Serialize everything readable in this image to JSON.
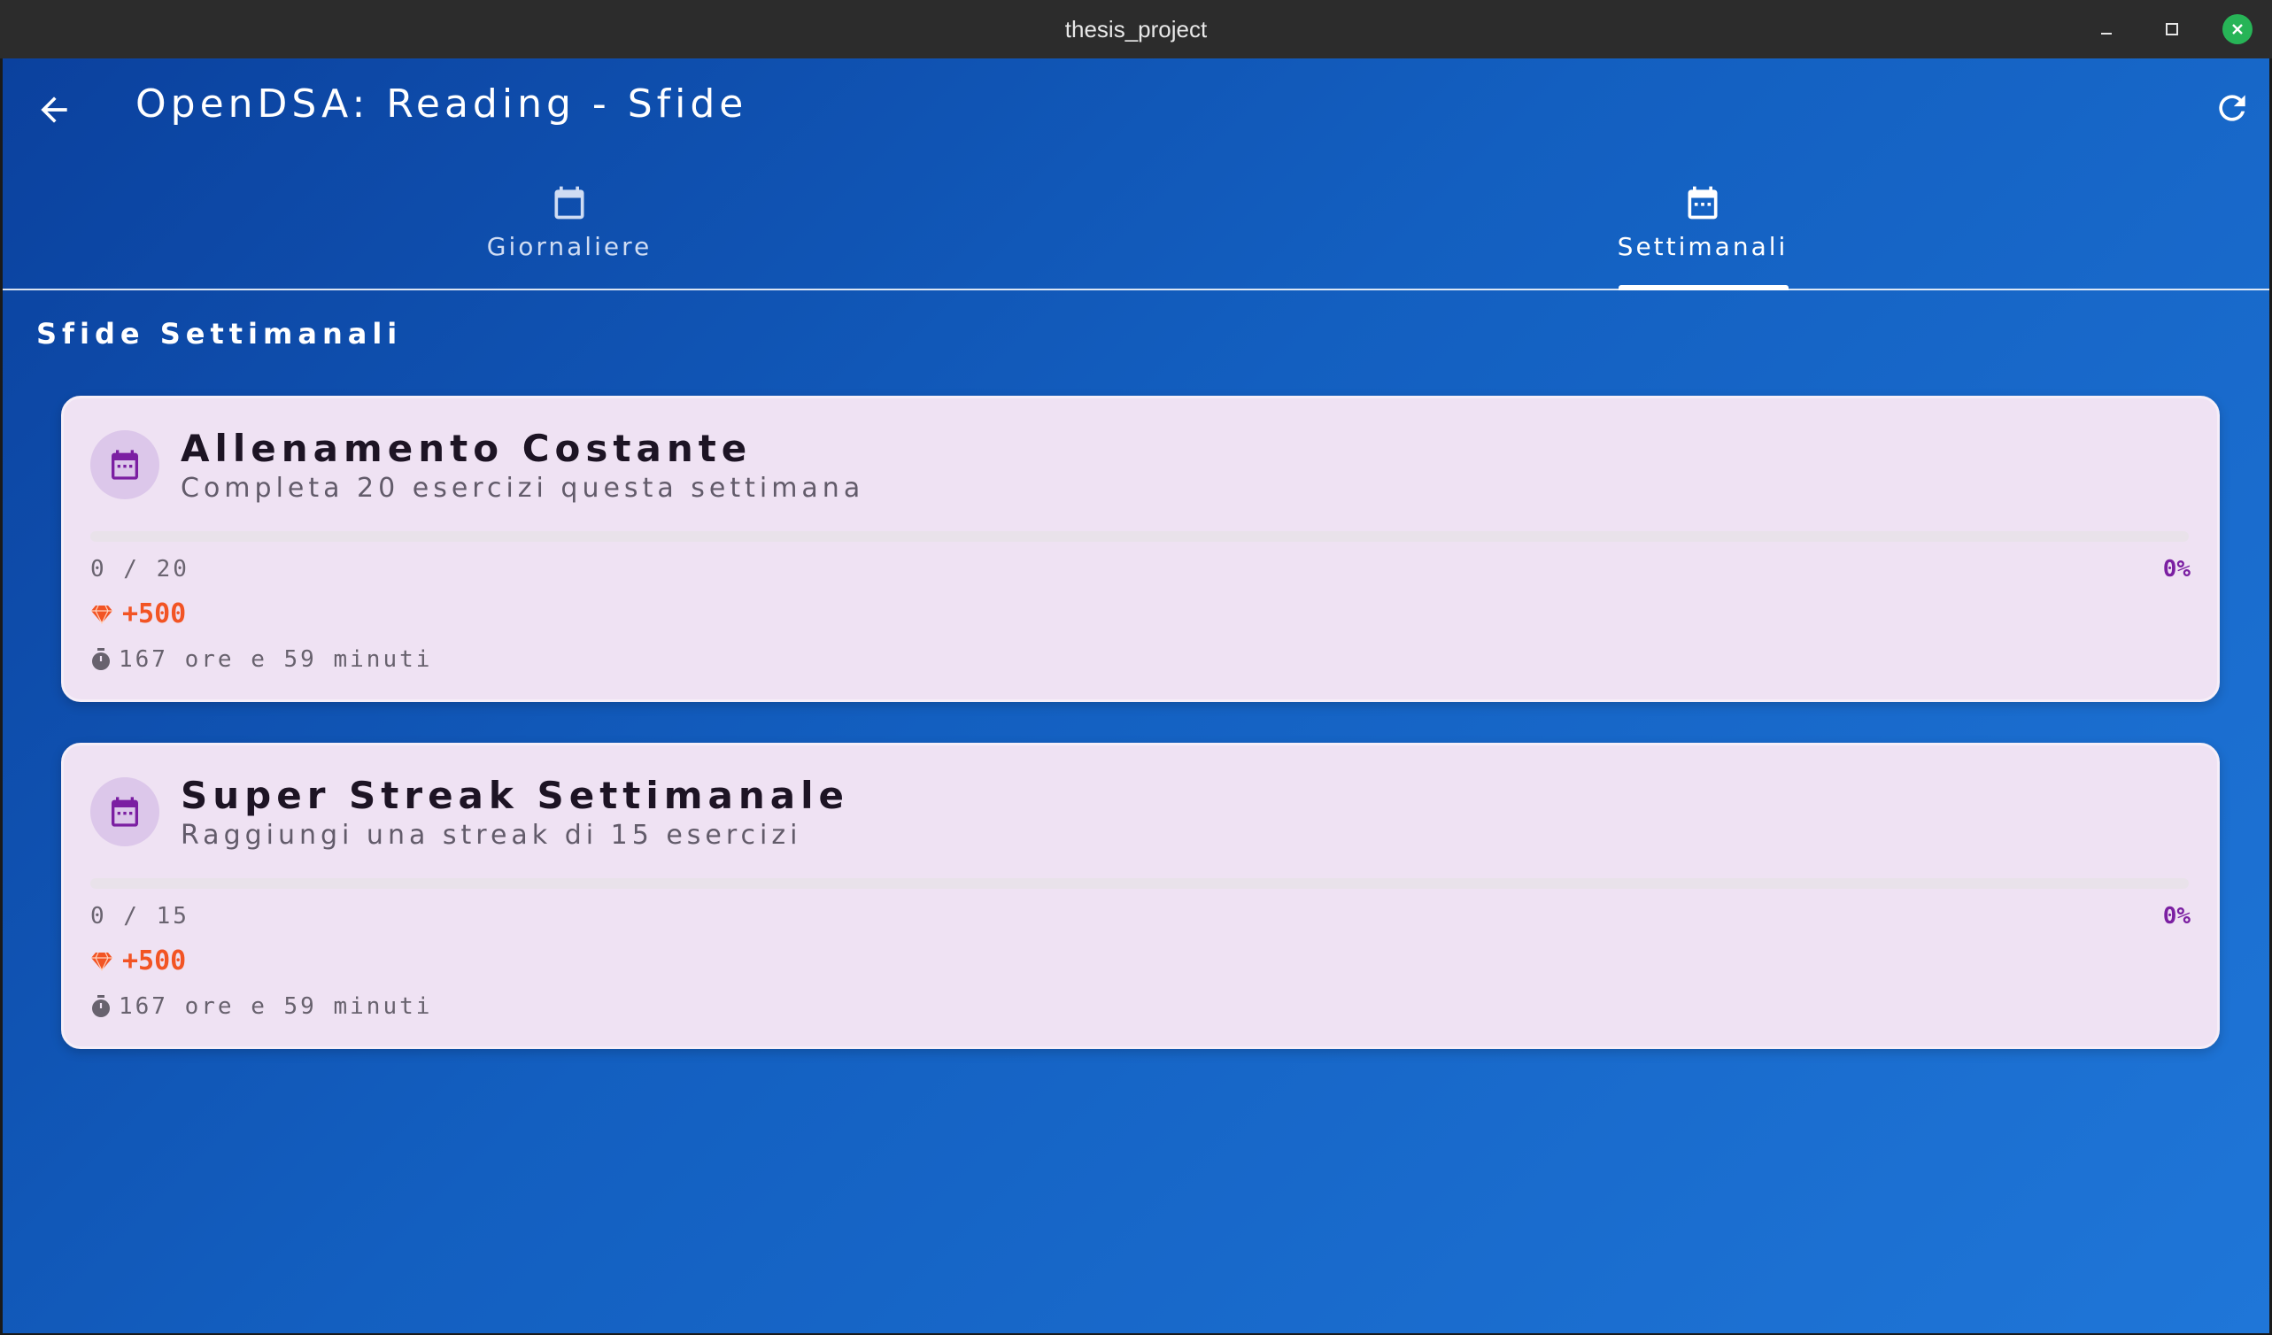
{
  "window": {
    "title": "thesis_project"
  },
  "appbar": {
    "title": "OpenDSA: Reading - Sfide"
  },
  "tabs": [
    {
      "label": "Giornaliere",
      "selected": false
    },
    {
      "label": "Settimanali",
      "selected": true
    }
  ],
  "section": {
    "title": "Sfide Settimanali"
  },
  "challenges": [
    {
      "title": "Allenamento Costante",
      "description": "Completa 20 esercizi questa settimana",
      "progress_text": "0 / 20",
      "progress_fraction": 0,
      "percent": "0%",
      "reward": "+500",
      "time_left": "167 ore e 59 minuti"
    },
    {
      "title": "Super Streak Settimanale",
      "description": "Raggiungi una streak di 15 esercizi",
      "progress_text": "0 / 15",
      "progress_fraction": 0,
      "percent": "0%",
      "reward": "+500",
      "time_left": "167 ore e 59 minuti"
    }
  ],
  "colors": {
    "accent": "#7b1fa2",
    "reward": "#f25424",
    "card_bg": "#efe2f3"
  },
  "icons": {
    "back": "arrow-back-icon",
    "refresh": "refresh-icon",
    "tab_daily": "calendar-icon",
    "tab_weekly": "calendar-week-icon",
    "card": "calendar-week-icon",
    "reward": "gem-icon",
    "timer": "stopwatch-icon"
  }
}
